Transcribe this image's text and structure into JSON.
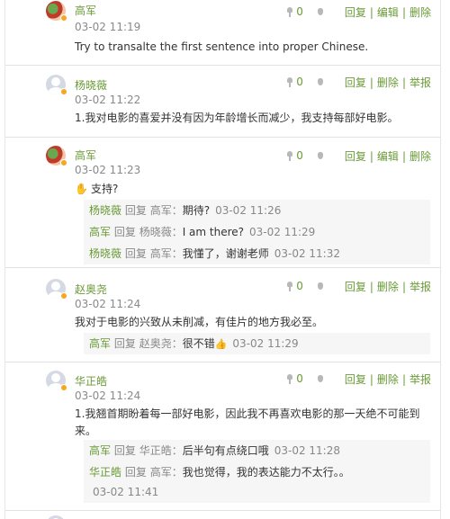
{
  "tool_icons": {
    "like": "thumb-up-icon",
    "dislike": "thumb-down-icon",
    "online_badge": "online-dot-icon"
  },
  "colors": {
    "accent": "#6a9a37",
    "muted": "#8a8a8a",
    "reply_bg": "#f6f6f6"
  },
  "comments": [
    {
      "author": "高军",
      "time": "03-02 11:19",
      "likes": "0",
      "actions": [
        "回复",
        "编辑",
        "删除"
      ],
      "body": "Try to transalte the first sentence into proper Chinese.",
      "replies": []
    },
    {
      "author": "杨晓薇",
      "time": "03-02 11:22",
      "likes": "0",
      "actions": [
        "回复",
        "删除",
        "举报"
      ],
      "body": "1.我对电影的喜爱并没有因为年龄增长而减少，我支持每部好电影。",
      "replies": []
    },
    {
      "author": "高军",
      "time": "03-02 11:23",
      "likes": "0",
      "actions": [
        "回复",
        "编辑",
        "删除"
      ],
      "body": "支持?",
      "body_icon": "raised-hand-icon",
      "replies": [
        {
          "from": "杨晓薇",
          "verb": "回复",
          "to": "高军：",
          "text": "期待?",
          "time": "03-02 11:26"
        },
        {
          "from": "高军",
          "verb": "回复",
          "to": "杨晓薇：",
          "text": "I am there?",
          "time": "03-02 11:29"
        },
        {
          "from": "杨晓薇",
          "verb": "回复",
          "to": "高军：",
          "text": "我懂了，谢谢老师",
          "time": "03-02 11:32"
        }
      ]
    },
    {
      "author": "赵奥尧",
      "time": "03-02 11:24",
      "likes": "0",
      "actions": [
        "回复",
        "删除",
        "举报"
      ],
      "body": "我对于电影的兴致从未削减，有佳片的地方我必至。",
      "replies": [
        {
          "from": "高军",
          "verb": "回复",
          "to": "赵奥尧：",
          "text": "很不错",
          "time": "03-02 11:29",
          "emoji": "thumbs-up-emoji"
        }
      ]
    },
    {
      "author": "华正皓",
      "time": "03-02 11:24",
      "likes": "0",
      "actions": [
        "回复",
        "删除",
        "举报"
      ],
      "body_line1": "1.我翘首期盼着每一部好电影，因此我不再喜欢电影的那一天绝不可能到",
      "body_line2": "来。",
      "replies": [
        {
          "from": "高军",
          "verb": "回复",
          "to": "华正皓：",
          "text": "后半句有点绕口哦",
          "time": "03-02 11:28"
        },
        {
          "from": "华正皓",
          "verb": "回复",
          "to": "高军：",
          "text": "我也觉得，我的表达能力不太行。。",
          "time": "03-02 11:41"
        }
      ]
    }
  ]
}
